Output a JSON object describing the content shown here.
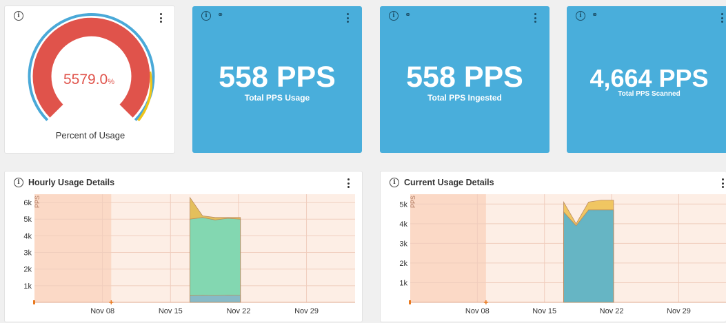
{
  "gauge": {
    "value": 5579.0,
    "value_text": "5579.0",
    "unit": "%",
    "label": "Percent of Usage",
    "colors": {
      "fill": "#e0534b",
      "outer": "#4aa9d8",
      "warning": "#f0c419"
    }
  },
  "stats": [
    {
      "value": "558 PPS",
      "label": "Total PPS Usage"
    },
    {
      "value": "558 PPS",
      "label": "Total PPS Ingested"
    },
    {
      "value": "4,664 PPS",
      "label": "Total PPS Scanned"
    }
  ],
  "icons": {
    "info": "info-icon",
    "link": "link-icon",
    "menu": "kebab-menu-icon"
  },
  "hourly": {
    "title": "Hourly Usage Details",
    "ylabel": "PPS",
    "yticks": [
      "1k",
      "2k",
      "3k",
      "4k",
      "5k",
      "6k"
    ],
    "xticks": [
      "Nov 08",
      "Nov 15",
      "Nov 22",
      "Nov 29"
    ]
  },
  "current": {
    "title": "Current Usage Details",
    "ylabel": "PPS",
    "yticks": [
      "1k",
      "2k",
      "3k",
      "4k",
      "5k"
    ],
    "xticks": [
      "Nov 08",
      "Nov 15",
      "Nov 22",
      "Nov 29"
    ]
  },
  "chart_data": [
    {
      "type": "area",
      "title": "Hourly Usage Details",
      "ylabel": "PPS",
      "ylim": [
        0,
        6500
      ],
      "x_ticks": [
        "Nov 08",
        "Nov 15",
        "Nov 22",
        "Nov 29"
      ],
      "x_range_days": [
        "Nov 01",
        "Dec 04"
      ],
      "active_period": [
        "Nov 17",
        "Nov 21"
      ],
      "series": [
        {
          "values": [
            5000,
            5100,
            4950,
            5050,
            5000
          ],
          "color": "#7ed9b6"
        },
        {
          "values": [
            400,
            420,
            410,
            430,
            420
          ],
          "color": "#88b9c9"
        },
        {
          "values": [
            6300,
            5200,
            5100,
            5100,
            5100
          ],
          "color": "#e3bd55"
        }
      ]
    },
    {
      "type": "area",
      "title": "Current Usage Details",
      "ylabel": "PPS",
      "ylim": [
        0,
        5500
      ],
      "x_ticks": [
        "Nov 08",
        "Nov 15",
        "Nov 22",
        "Nov 29"
      ],
      "x_range_days": [
        "Nov 01",
        "Dec 04"
      ],
      "active_period": [
        "Nov 17",
        "Nov 21"
      ],
      "series": [
        {
          "values": [
            4500,
            3800,
            4600,
            4650,
            4650
          ],
          "color": "#f9bc7c"
        },
        {
          "values": [
            4600,
            3900,
            4700,
            4700,
            4700
          ],
          "color": "#5fb5c9"
        },
        {
          "values": [
            5100,
            4000,
            5100,
            5200,
            5200
          ],
          "color": "#f0c45c"
        }
      ]
    }
  ]
}
